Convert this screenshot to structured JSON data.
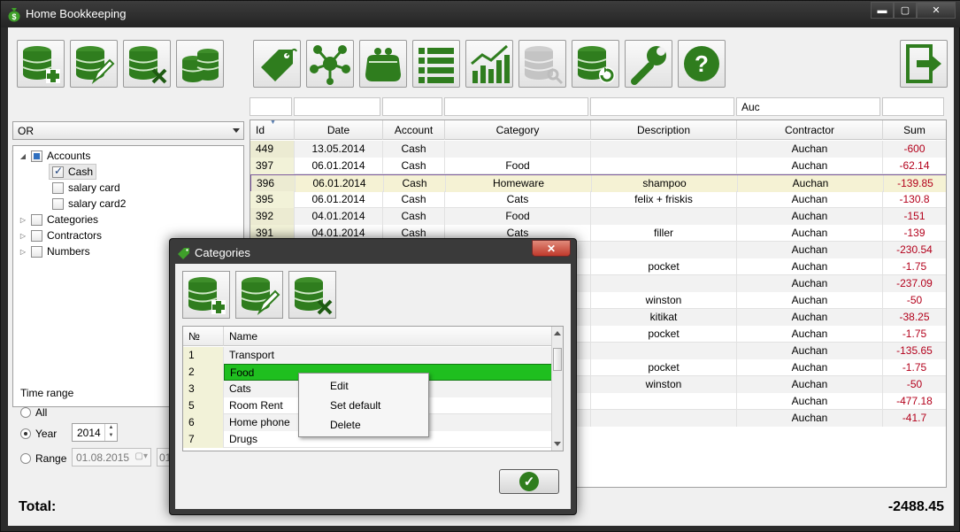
{
  "window": {
    "title": "Home Bookkeeping",
    "controls": {
      "minimize": "▬",
      "maximize": "▢",
      "close": "✕"
    }
  },
  "toolbar": {
    "icons": [
      "database-add-icon",
      "database-edit-icon",
      "database-delete-icon",
      "coins-stack-icon",
      "tag-icon",
      "network-icon",
      "purse-icon",
      "list-icon",
      "chart-icon",
      "database-key-icon",
      "database-restore-icon",
      "wrench-icon",
      "help-icon",
      "exit-icon"
    ],
    "accent_color": "#2f7d1e"
  },
  "left_panel": {
    "filter_mode": "OR",
    "tree": [
      {
        "label": "Accounts",
        "state": "partial",
        "expanded": true
      },
      {
        "label": "Cash",
        "state": "checked"
      },
      {
        "label": "salary card",
        "state": "unchecked"
      },
      {
        "label": "salary card2",
        "state": "unchecked"
      },
      {
        "label": "Categories",
        "state": "unchecked",
        "expanded": false
      },
      {
        "label": "Contractors",
        "state": "unchecked",
        "expanded": false
      },
      {
        "label": "Numbers",
        "state": "unchecked",
        "expanded": false
      }
    ],
    "time_range": {
      "label": "Time range",
      "all_label": "All",
      "year_label": "Year",
      "year_value": "2014",
      "range_label": "Range",
      "range_from": "01.08.2015",
      "range_to": "01",
      "selected": "year"
    }
  },
  "filters": {
    "contractor": "Auc"
  },
  "grid": {
    "columns": [
      "Id",
      "Date",
      "Account",
      "Category",
      "Description",
      "Contractor",
      "Sum"
    ],
    "rows": [
      [
        "449",
        "13.05.2014",
        "Cash",
        "",
        "",
        "Auchan",
        "-600"
      ],
      [
        "397",
        "06.01.2014",
        "Cash",
        "Food",
        "",
        "Auchan",
        "-62.14"
      ],
      [
        "396",
        "06.01.2014",
        "Cash",
        "Homeware",
        "shampoo",
        "Auchan",
        "-139.85"
      ],
      [
        "395",
        "06.01.2014",
        "Cash",
        "Cats",
        "felix + friskis",
        "Auchan",
        "-130.8"
      ],
      [
        "392",
        "04.01.2014",
        "Cash",
        "Food",
        "",
        "Auchan",
        "-151"
      ],
      [
        "391",
        "04.01.2014",
        "Cash",
        "Cats",
        "filler",
        "Auchan",
        "-139"
      ],
      [
        "",
        "",
        "",
        "",
        "",
        "Auchan",
        "-230.54"
      ],
      [
        "",
        "",
        "",
        "",
        "pocket",
        "Auchan",
        "-1.75"
      ],
      [
        "",
        "",
        "",
        "",
        "",
        "Auchan",
        "-237.09"
      ],
      [
        "",
        "",
        "",
        "",
        "winston",
        "Auchan",
        "-50"
      ],
      [
        "",
        "",
        "",
        "",
        "kitikat",
        "Auchan",
        "-38.25"
      ],
      [
        "",
        "",
        "",
        "",
        "pocket",
        "Auchan",
        "-1.75"
      ],
      [
        "",
        "",
        "",
        "",
        "",
        "Auchan",
        "-135.65"
      ],
      [
        "",
        "",
        "",
        "",
        "pocket",
        "Auchan",
        "-1.75"
      ],
      [
        "",
        "",
        "",
        "",
        "winston",
        "Auchan",
        "-50"
      ],
      [
        "",
        "",
        "",
        "",
        "",
        "Auchan",
        "-477.18"
      ],
      [
        "",
        "",
        "",
        "",
        "",
        "Auchan",
        "-41.7"
      ]
    ],
    "highlighted_row_id": "396"
  },
  "total": {
    "label": "Total:",
    "value": "-2488.45"
  },
  "dialog": {
    "title": "Categories",
    "close_label": "✕",
    "columns": [
      "№",
      "Name"
    ],
    "rows": [
      [
        "1",
        "Transport"
      ],
      [
        "2",
        "Food"
      ],
      [
        "3",
        "Cats"
      ],
      [
        "5",
        "Room Rent"
      ],
      [
        "6",
        "Home phone"
      ],
      [
        "7",
        "Drugs"
      ]
    ],
    "selected_index": 1,
    "ok_label": "✓"
  },
  "context_menu": {
    "items": [
      "Edit",
      "Set default",
      "Delete"
    ]
  }
}
